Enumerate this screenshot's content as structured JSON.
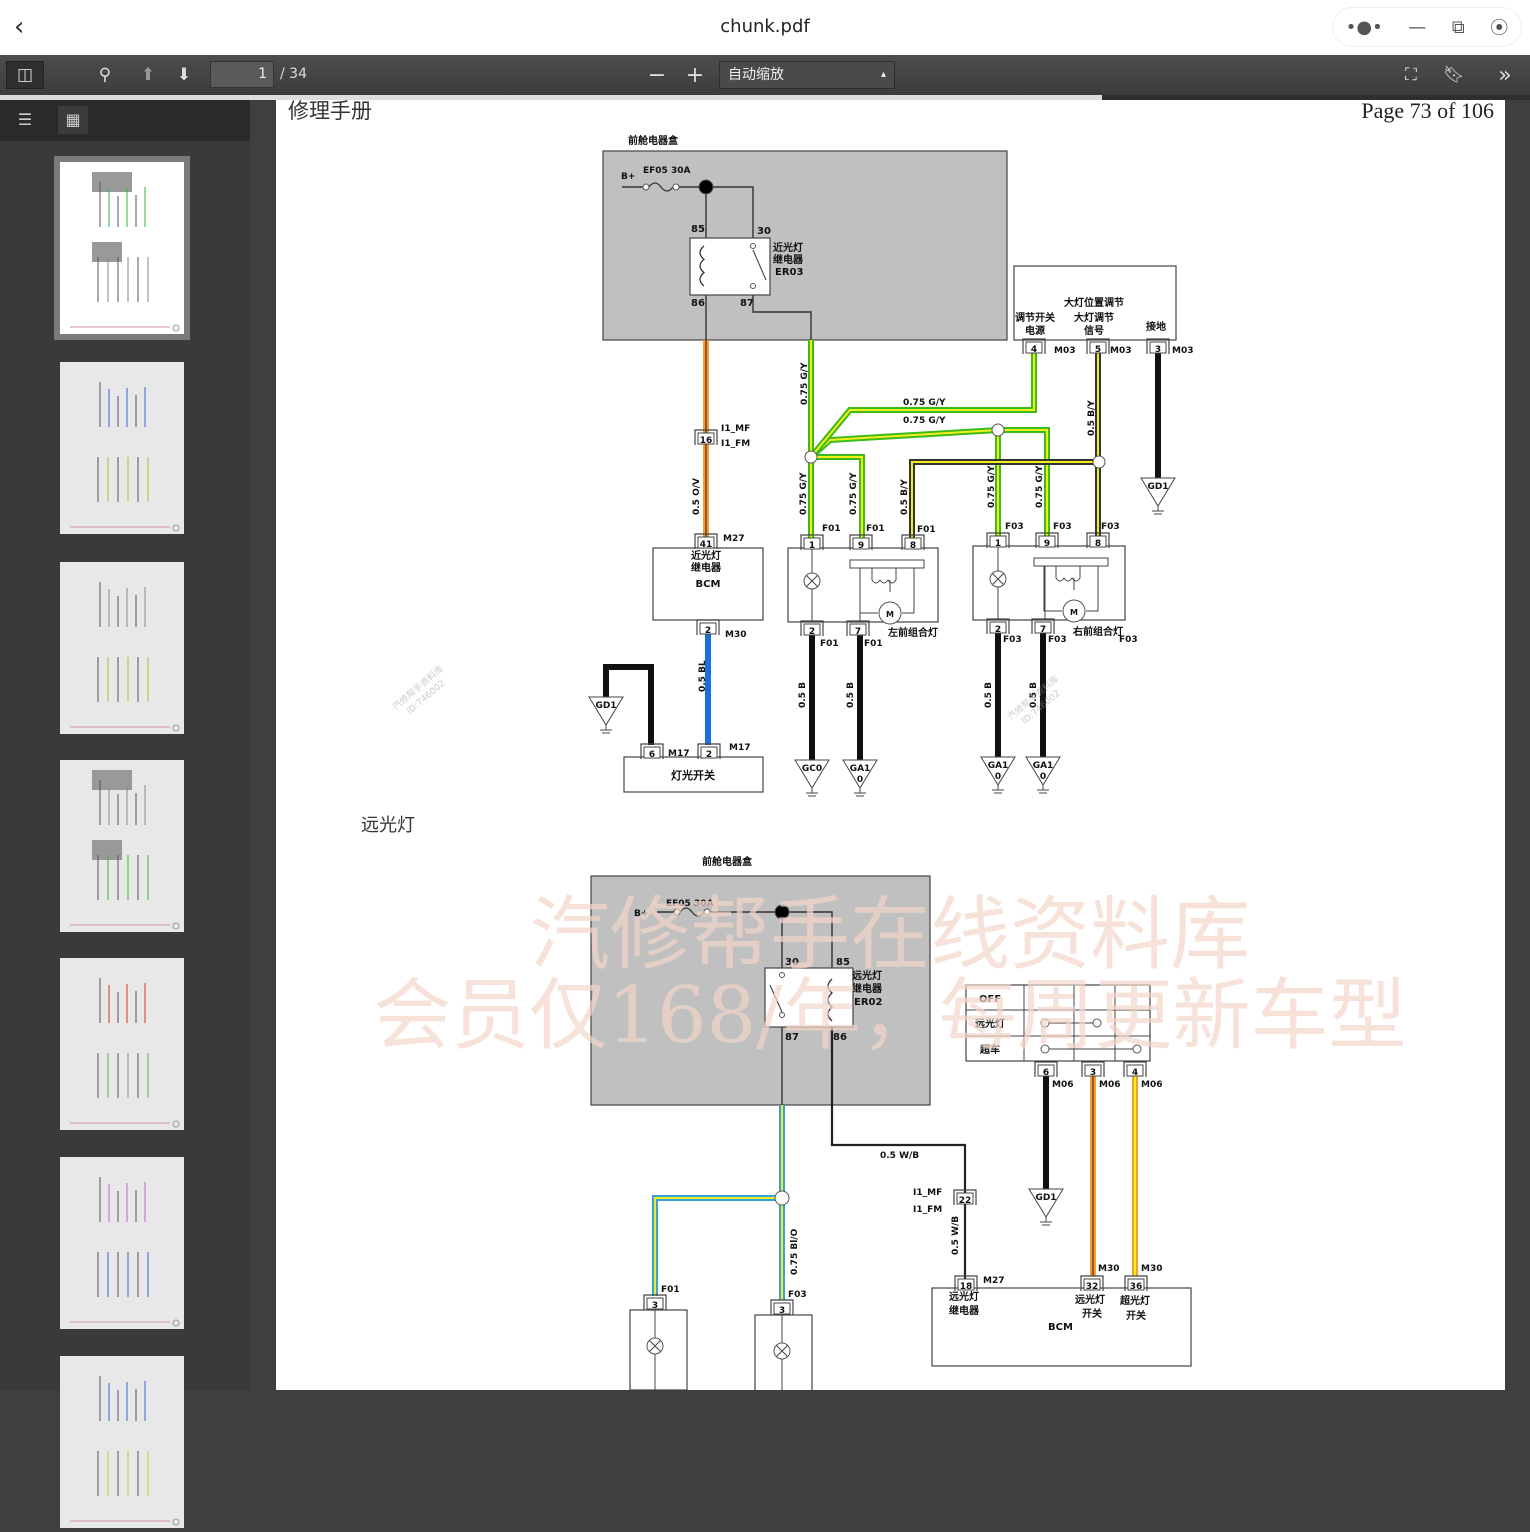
{
  "window": {
    "title": "chunk.pdf",
    "back_icon": "chevron-left-icon"
  },
  "toolbar": {
    "page_current": "1",
    "page_total": "/ 34",
    "zoom": "自动缩放"
  },
  "progress": {
    "fraction": 0.72
  },
  "page": {
    "header_left": "修理手册",
    "header_right": "Page 73 of 106",
    "section_title": "远光灯"
  },
  "watermark": {
    "line1": "汽修帮手在线资料库",
    "line2": "会员仅168/年，每周更新车型",
    "small1": "汽修帮手资料库",
    "small2": "ID:746002"
  },
  "colors": {
    "box_gray": "#c0c0c0",
    "green": "#3dbb1a",
    "yellow": "#f2ee1c",
    "orange": "#f0a030",
    "brown": "#a0522d",
    "blue": "#1b6fd6",
    "black": "#111111",
    "watermark": "#f3d6c8"
  },
  "low_beam": {
    "labels": [
      "前舱电器盒",
      "B+",
      "EF05 30A",
      "85",
      "30",
      "86",
      "87",
      "近光灯",
      "继电器",
      "ER03",
      "I1_MF",
      "I1_FM",
      "16",
      "0.5 O/V",
      "41",
      "M27",
      "近光灯",
      "继电器",
      "BCM",
      "2",
      "M30",
      "0.5 BL",
      "6",
      "M17",
      "2",
      "M17",
      "灯光开关",
      "GD1",
      "0.75 G/Y",
      "0.75 G/Y",
      "0.75 G/Y",
      "0.5 B/Y",
      "大灯位置调节",
      "调节开关",
      "电源",
      "大灯调节",
      "信号",
      "接地",
      "4",
      "M03",
      "5",
      "M03",
      "3",
      "M03",
      "GD1",
      "0.75 G/Y",
      "0.75 G/Y",
      "0.5 B/Y",
      "0.75 G/Y",
      "0.75 G/Y",
      "F01",
      "1",
      "F01",
      "9",
      "F01",
      "8",
      "2",
      "F01",
      "7",
      "F01",
      "左前组合灯",
      "F03",
      "1",
      "F03",
      "9",
      "F03",
      "8",
      "2",
      "F03",
      "7",
      "F03",
      "右前组合灯",
      "F03",
      "0.5 B",
      "0.5 B",
      "0.5 B",
      "0.5 B",
      "GC0",
      "GA1",
      "0",
      "GA1",
      "0",
      "GA1",
      "0",
      "M",
      "M"
    ]
  },
  "high_beam": {
    "labels": [
      "前舱电器盒",
      "B+",
      "EF05 30A",
      "30",
      "85",
      "87",
      "86",
      "远光灯",
      "继电器",
      "ER02",
      "OFF",
      "远光灯",
      "超车",
      "6",
      "M06",
      "3",
      "M06",
      "4",
      "M06",
      "GD1",
      "0.5 W/B",
      "I1_MF",
      "I1_FM",
      "22",
      "0.5 W/B",
      "18",
      "M27",
      "32",
      "M30",
      "36",
      "M30",
      "远光灯",
      "继电器",
      "远光灯",
      "开关",
      "超光灯",
      "开关",
      "BCM",
      "0.75 Bl/O",
      "F01",
      "3",
      "F03",
      "3"
    ]
  }
}
